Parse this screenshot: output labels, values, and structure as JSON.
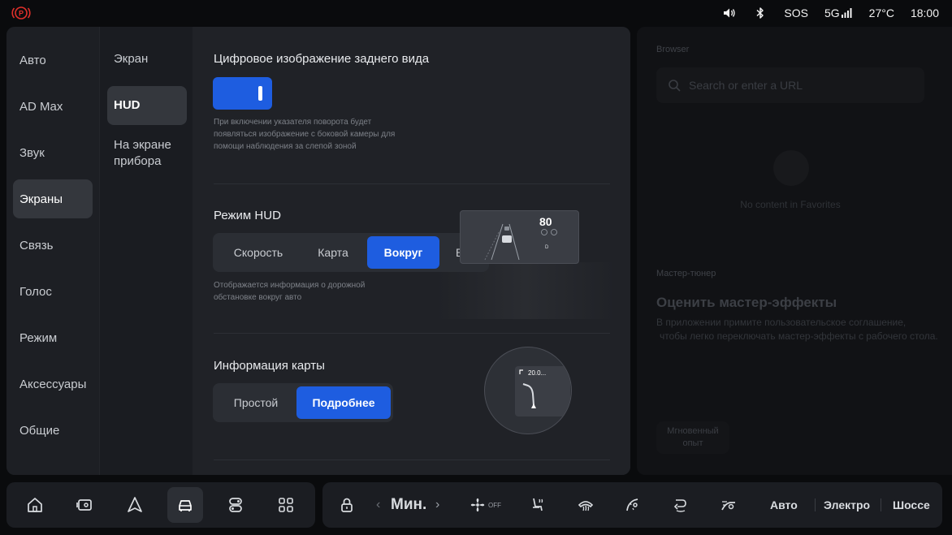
{
  "status": {
    "sos": "SOS",
    "network": "5G",
    "temperature": "27°C",
    "time": "18:00"
  },
  "nav_primary": [
    {
      "label": "Авто"
    },
    {
      "label": "AD Max"
    },
    {
      "label": "Звук"
    },
    {
      "label": "Экраны",
      "active": true
    },
    {
      "label": "Связь"
    },
    {
      "label": "Голос"
    },
    {
      "label": "Режим"
    },
    {
      "label": "Аксессуары"
    },
    {
      "label": "Общие"
    }
  ],
  "nav_secondary": [
    {
      "label": "Экран"
    },
    {
      "label": "HUD",
      "active": true
    },
    {
      "label": "На экране прибора"
    }
  ],
  "rear_view": {
    "title": "Цифровое изображение заднего вида",
    "toggle_on": true,
    "hint_line1": "При включении указателя поворота будет",
    "hint_line2": "появляться изображение с боковой камеры для",
    "hint_line3": "помощи наблюдения за слепой зоной"
  },
  "hud_mode": {
    "title": "Режим HUD",
    "options": [
      "Скорость",
      "Карта",
      "Вокруг",
      "Все"
    ],
    "selected": "Вокруг",
    "hint_line1": "Отображается информация о дорожной",
    "hint_line2": "обстановке вокруг авто",
    "preview_speed": "80"
  },
  "map_info": {
    "title": "Информация карты",
    "options": [
      "Простой",
      "Подробнее"
    ],
    "selected": "Подробнее",
    "preview_distance": "20.0..."
  },
  "side_panel": {
    "browser_label": "Browser",
    "search_placeholder": "Search or enter a URL",
    "empty_text": "No content in Favorites",
    "tuner_label": "Мастер-тюнер",
    "heading": "Оценить мастер-эффекты",
    "body_line1": "В приложении примите пользовательское соглашение,",
    "body_line2": "чтобы легко переключать мастер-эффекты с рабочего стола.",
    "instant_line1": "Мгновенный",
    "instant_line2": "опыт"
  },
  "dock": {
    "fan_level": "Мин.",
    "fan_off": "OFF",
    "mode_auto": "Авто",
    "mode_electric": "Электро",
    "mode_highway": "Шоссе"
  },
  "colors": {
    "accent": "#1e5de0",
    "panel": "#1b1d22",
    "brake_warning": "#e0302a"
  }
}
